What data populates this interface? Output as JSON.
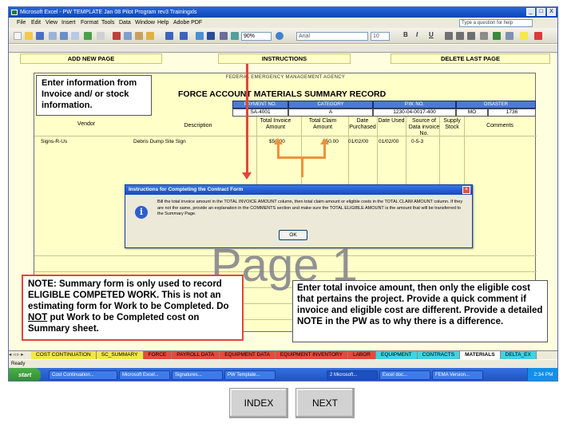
{
  "window": {
    "title": "Microsoft Excel - PW TEMPLATE Jan 08 Pilot Program rev3 Trainingxls",
    "controls": [
      "_",
      "□",
      "X"
    ]
  },
  "menu": {
    "items": [
      "File",
      "Edit",
      "View",
      "Insert",
      "Format",
      "Tools",
      "Data",
      "Window",
      "Help",
      "Adobe PDF"
    ],
    "ask_placeholder": "Type a question for help"
  },
  "toolbar": {
    "zoom": "90%",
    "font": "Arial",
    "size": "10",
    "bold": "B",
    "italic": "I",
    "underline": "U"
  },
  "sheet_buttons": {
    "add_new_page": "ADD NEW PAGE",
    "instructions": "INSTRUCTIONS",
    "delete_last_page": "DELETE LAST PAGE"
  },
  "form": {
    "agency": "FEDERAL EMERGENCY MANAGEMENT AGENCY",
    "title": "FORCE ACCOUNT MATERIALS SUMMARY RECORD",
    "header_labels": [
      "PAYMENT NO.",
      "CATEGORY",
      "P.W. NO.",
      "DISASTER"
    ],
    "header_values": [
      "SA-4001",
      "A",
      "1230-04-0017-400",
      "MO",
      "1736"
    ],
    "column_headers": [
      "Vendor",
      "Description",
      "Total Invoice Amount",
      "Total Claim Amount",
      "Date Purchased",
      "Date Used",
      "Source of Data invoice No.",
      "Supply Stock",
      "Comments"
    ],
    "row": {
      "vendor": "Signs-R-Us",
      "description": "Debris Dump Site Sign",
      "invoice": "$50.00",
      "claim": "$50.00",
      "purchased": "01/02/00",
      "used": "01/02/00",
      "source": "0-5-3"
    },
    "watermark": "Page 1"
  },
  "dialog": {
    "title": "Instructions for Completing the Contract Form",
    "text": "Bill the total invoice amount in the TOTAL INVOICE AMOUNT column, then total claim amount or eligible costs in the TOTAL CLAIM AMOUNT column. If they are not the same, provide an explanation in the COMMENTS section and make sure the TOTAL ELIGIBLE AMOUNT is the amount that will be transferred to the Summary Page.",
    "ok": "OK"
  },
  "callouts": {
    "invoice": "Enter information from Invoice and/ or stock information.",
    "note_prefix": "NOTE: Summary form is only used to record ELIGIBLE COMPETED WORK.  This is not an estimating form for Work to be Completed. Do ",
    "note_not": "NOT",
    "note_suffix": " put Work to be Completed cost on Summary sheet.",
    "total": "Enter total invoice amount, then only the eligible cost that pertains the project.  Provide a quick comment if invoice and eligible cost are different. Provide a detailed NOTE in the PW as to why there is a difference."
  },
  "tabs": [
    {
      "label": "COST CONTINUATION",
      "color": "yellow"
    },
    {
      "label": "SC_SUMMARY",
      "color": "yellow"
    },
    {
      "label": "FORCE",
      "color": "red"
    },
    {
      "label": "PAYROLL DATA",
      "color": "red"
    },
    {
      "label": "EQUIPMENT DATA",
      "color": "red"
    },
    {
      "label": "EQUIPMENT INVENTORY",
      "color": "red"
    },
    {
      "label": "LABOR",
      "color": "red"
    },
    {
      "label": "EQUIPMENT",
      "color": "cyan"
    },
    {
      "label": "CONTRACTS",
      "color": "cyan"
    },
    {
      "label": "MATERIALS",
      "color": "active"
    },
    {
      "label": "DELTA_EX",
      "color": "cyan"
    }
  ],
  "status": "Ready",
  "taskbar": {
    "start": "start",
    "buttons": [
      "Cost Continuation...",
      "Microsoft Excel...",
      "Signatures...",
      "PW Template...",
      "2 Microsoft...",
      "Excel doc...",
      "FEMA Version..."
    ],
    "clock": "2:34 PM"
  },
  "nav": {
    "index": "INDEX",
    "next": "NEXT"
  }
}
